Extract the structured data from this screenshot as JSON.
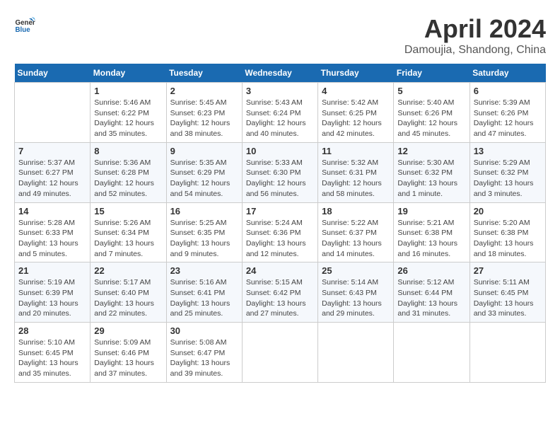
{
  "app": {
    "logo_line1": "General",
    "logo_line2": "Blue"
  },
  "calendar": {
    "month": "April 2024",
    "location": "Damoujia, Shandong, China",
    "headers": [
      "Sunday",
      "Monday",
      "Tuesday",
      "Wednesday",
      "Thursday",
      "Friday",
      "Saturday"
    ],
    "weeks": [
      [
        {
          "num": "",
          "info": ""
        },
        {
          "num": "1",
          "info": "Sunrise: 5:46 AM\nSunset: 6:22 PM\nDaylight: 12 hours\nand 35 minutes."
        },
        {
          "num": "2",
          "info": "Sunrise: 5:45 AM\nSunset: 6:23 PM\nDaylight: 12 hours\nand 38 minutes."
        },
        {
          "num": "3",
          "info": "Sunrise: 5:43 AM\nSunset: 6:24 PM\nDaylight: 12 hours\nand 40 minutes."
        },
        {
          "num": "4",
          "info": "Sunrise: 5:42 AM\nSunset: 6:25 PM\nDaylight: 12 hours\nand 42 minutes."
        },
        {
          "num": "5",
          "info": "Sunrise: 5:40 AM\nSunset: 6:26 PM\nDaylight: 12 hours\nand 45 minutes."
        },
        {
          "num": "6",
          "info": "Sunrise: 5:39 AM\nSunset: 6:26 PM\nDaylight: 12 hours\nand 47 minutes."
        }
      ],
      [
        {
          "num": "7",
          "info": "Sunrise: 5:37 AM\nSunset: 6:27 PM\nDaylight: 12 hours\nand 49 minutes."
        },
        {
          "num": "8",
          "info": "Sunrise: 5:36 AM\nSunset: 6:28 PM\nDaylight: 12 hours\nand 52 minutes."
        },
        {
          "num": "9",
          "info": "Sunrise: 5:35 AM\nSunset: 6:29 PM\nDaylight: 12 hours\nand 54 minutes."
        },
        {
          "num": "10",
          "info": "Sunrise: 5:33 AM\nSunset: 6:30 PM\nDaylight: 12 hours\nand 56 minutes."
        },
        {
          "num": "11",
          "info": "Sunrise: 5:32 AM\nSunset: 6:31 PM\nDaylight: 12 hours\nand 58 minutes."
        },
        {
          "num": "12",
          "info": "Sunrise: 5:30 AM\nSunset: 6:32 PM\nDaylight: 13 hours\nand 1 minute."
        },
        {
          "num": "13",
          "info": "Sunrise: 5:29 AM\nSunset: 6:32 PM\nDaylight: 13 hours\nand 3 minutes."
        }
      ],
      [
        {
          "num": "14",
          "info": "Sunrise: 5:28 AM\nSunset: 6:33 PM\nDaylight: 13 hours\nand 5 minutes."
        },
        {
          "num": "15",
          "info": "Sunrise: 5:26 AM\nSunset: 6:34 PM\nDaylight: 13 hours\nand 7 minutes."
        },
        {
          "num": "16",
          "info": "Sunrise: 5:25 AM\nSunset: 6:35 PM\nDaylight: 13 hours\nand 9 minutes."
        },
        {
          "num": "17",
          "info": "Sunrise: 5:24 AM\nSunset: 6:36 PM\nDaylight: 13 hours\nand 12 minutes."
        },
        {
          "num": "18",
          "info": "Sunrise: 5:22 AM\nSunset: 6:37 PM\nDaylight: 13 hours\nand 14 minutes."
        },
        {
          "num": "19",
          "info": "Sunrise: 5:21 AM\nSunset: 6:38 PM\nDaylight: 13 hours\nand 16 minutes."
        },
        {
          "num": "20",
          "info": "Sunrise: 5:20 AM\nSunset: 6:38 PM\nDaylight: 13 hours\nand 18 minutes."
        }
      ],
      [
        {
          "num": "21",
          "info": "Sunrise: 5:19 AM\nSunset: 6:39 PM\nDaylight: 13 hours\nand 20 minutes."
        },
        {
          "num": "22",
          "info": "Sunrise: 5:17 AM\nSunset: 6:40 PM\nDaylight: 13 hours\nand 22 minutes."
        },
        {
          "num": "23",
          "info": "Sunrise: 5:16 AM\nSunset: 6:41 PM\nDaylight: 13 hours\nand 25 minutes."
        },
        {
          "num": "24",
          "info": "Sunrise: 5:15 AM\nSunset: 6:42 PM\nDaylight: 13 hours\nand 27 minutes."
        },
        {
          "num": "25",
          "info": "Sunrise: 5:14 AM\nSunset: 6:43 PM\nDaylight: 13 hours\nand 29 minutes."
        },
        {
          "num": "26",
          "info": "Sunrise: 5:12 AM\nSunset: 6:44 PM\nDaylight: 13 hours\nand 31 minutes."
        },
        {
          "num": "27",
          "info": "Sunrise: 5:11 AM\nSunset: 6:45 PM\nDaylight: 13 hours\nand 33 minutes."
        }
      ],
      [
        {
          "num": "28",
          "info": "Sunrise: 5:10 AM\nSunset: 6:45 PM\nDaylight: 13 hours\nand 35 minutes."
        },
        {
          "num": "29",
          "info": "Sunrise: 5:09 AM\nSunset: 6:46 PM\nDaylight: 13 hours\nand 37 minutes."
        },
        {
          "num": "30",
          "info": "Sunrise: 5:08 AM\nSunset: 6:47 PM\nDaylight: 13 hours\nand 39 minutes."
        },
        {
          "num": "",
          "info": ""
        },
        {
          "num": "",
          "info": ""
        },
        {
          "num": "",
          "info": ""
        },
        {
          "num": "",
          "info": ""
        }
      ]
    ]
  }
}
